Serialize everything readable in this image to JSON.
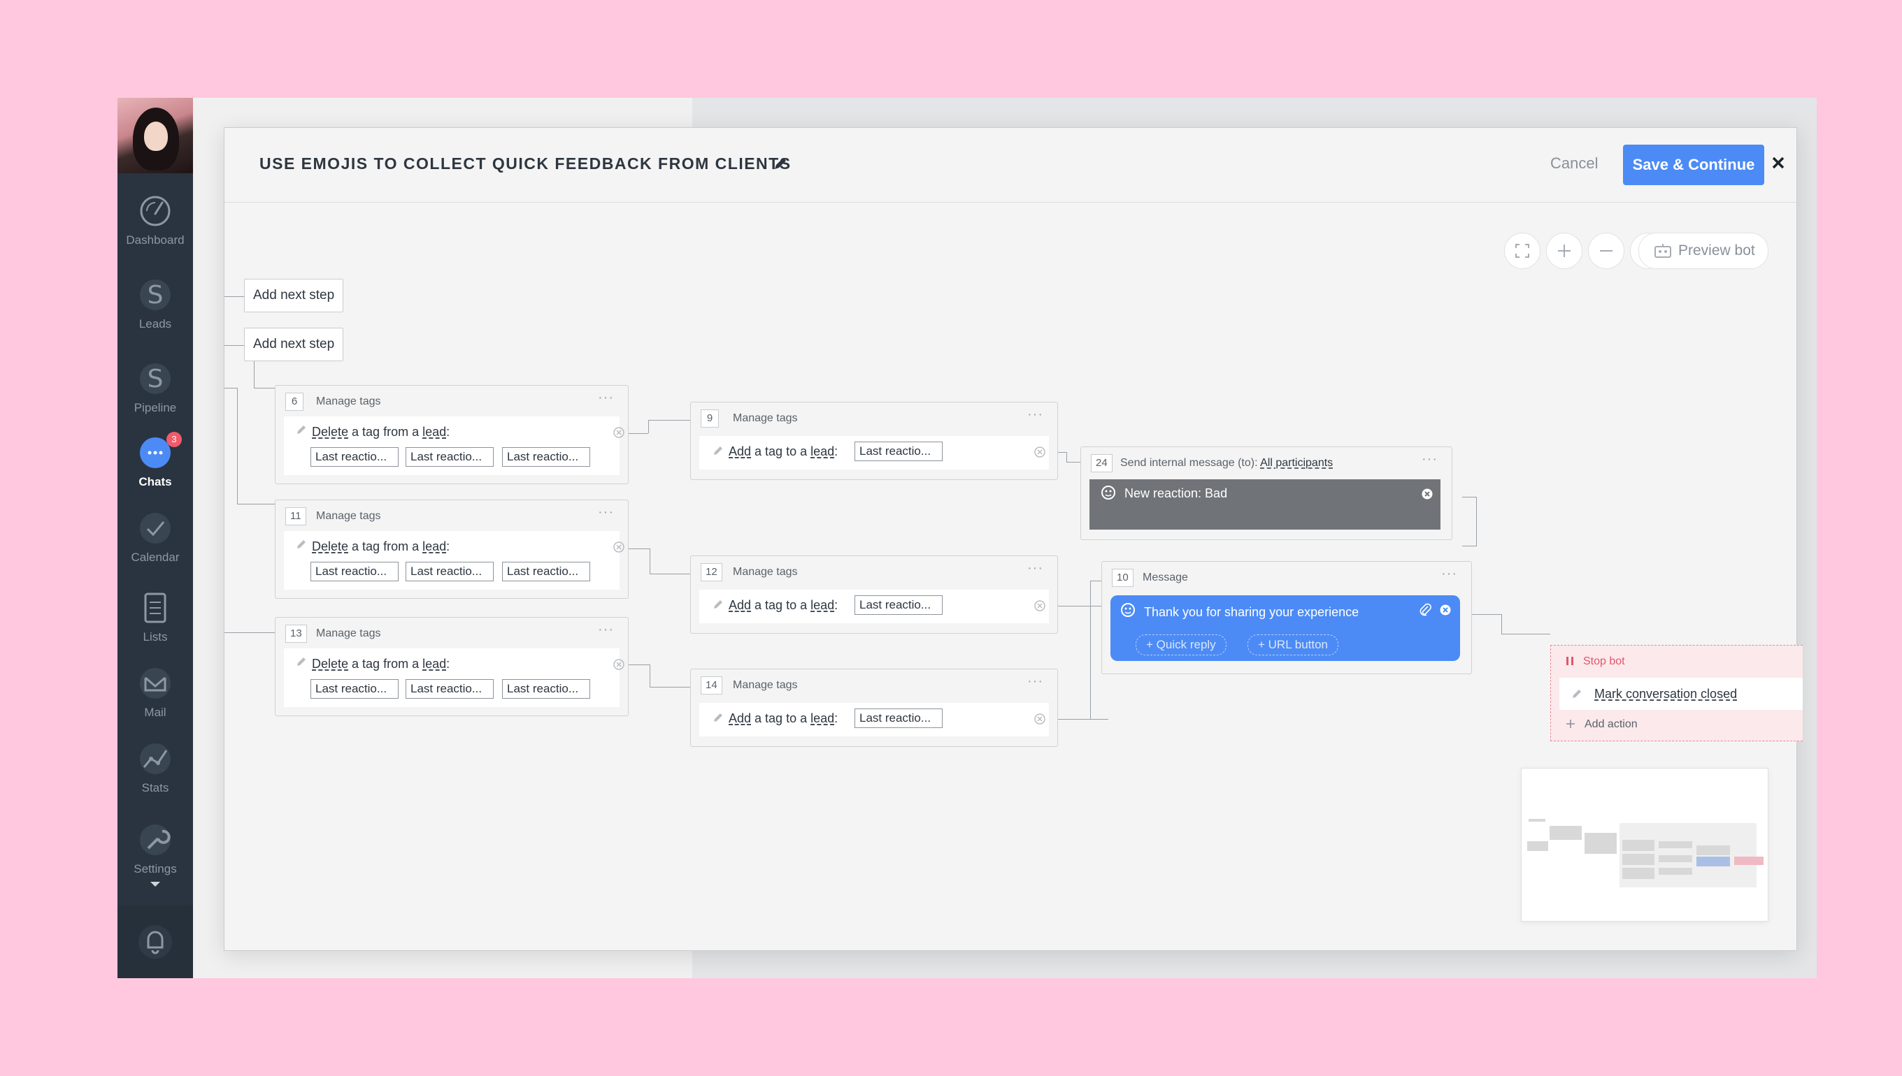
{
  "sidebar": {
    "items": [
      {
        "label": "Dashboard",
        "icon": "dashboard-icon"
      },
      {
        "label": "Leads",
        "icon": "dollar-icon"
      },
      {
        "label": "Pipeline",
        "icon": "dollar-icon"
      },
      {
        "label": "Chats",
        "icon": "chat-icon",
        "badge": "3",
        "active": true
      },
      {
        "label": "Calendar",
        "icon": "check-icon"
      },
      {
        "label": "Lists",
        "icon": "list-icon"
      },
      {
        "label": "Mail",
        "icon": "mail-icon"
      },
      {
        "label": "Stats",
        "icon": "stats-icon"
      },
      {
        "label": "Settings",
        "icon": "wrench-icon"
      }
    ],
    "bell_icon": "bell-icon"
  },
  "modal": {
    "title": "USE EMOJIS TO COLLECT QUICK FEEDBACK FROM CLIENTS",
    "cancel_label": "Cancel",
    "save_label": "Save & Continue",
    "preview_label": "Preview bot",
    "toolbar_icons": [
      "fullscreen-icon",
      "zoom-in-icon",
      "zoom-out-icon",
      "magic-wand-icon",
      "code-icon",
      "export-icon",
      "preview-bot-icon"
    ]
  },
  "canvas": {
    "add_step_1": "Add next step",
    "add_step_2": "Add next step",
    "cards": [
      {
        "num": "6",
        "title": "Manage tags",
        "verb": "Delete",
        "mid": " a tag from a ",
        "obj": "lead",
        "colon": ":",
        "chips": [
          "Last reactio...",
          "Last reactio...",
          "Last reactio..."
        ]
      },
      {
        "num": "11",
        "title": "Manage tags",
        "verb": "Delete",
        "mid": " a tag from a ",
        "obj": "lead",
        "colon": ":",
        "chips": [
          "Last reactio...",
          "Last reactio...",
          "Last reactio..."
        ]
      },
      {
        "num": "13",
        "title": "Manage tags",
        "verb": "Delete",
        "mid": " a tag from a ",
        "obj": "lead",
        "colon": ":",
        "chips": [
          "Last reactio...",
          "Last reactio...",
          "Last reactio..."
        ]
      },
      {
        "num": "9",
        "title": "Manage tags",
        "verb": "Add",
        "mid": " a tag to a ",
        "obj": "lead",
        "colon": ":",
        "chips": [
          "Last reactio..."
        ]
      },
      {
        "num": "12",
        "title": "Manage tags",
        "verb": "Add",
        "mid": " a tag to a ",
        "obj": "lead",
        "colon": ":",
        "chips": [
          "Last reactio..."
        ]
      },
      {
        "num": "14",
        "title": "Manage tags",
        "verb": "Add",
        "mid": " a tag to a ",
        "obj": "lead",
        "colon": ":",
        "chips": [
          "Last reactio..."
        ]
      }
    ],
    "internal": {
      "num": "24",
      "title": "Send internal message (to):",
      "to": "All participants",
      "text": "New reaction: Bad"
    },
    "message": {
      "num": "10",
      "title": "Message",
      "text": "Thank you for sharing your experience",
      "quick_reply": "+ Quick reply",
      "url_button": "+ URL button"
    },
    "stop": {
      "title": "Stop bot",
      "action": "Mark conversation closed",
      "add_action": "Add action"
    }
  },
  "colors": {
    "accent": "#4c8bf5",
    "sidebar": "#2a3440",
    "page_bg": "#ffc8de",
    "stop": "#e0566a"
  }
}
